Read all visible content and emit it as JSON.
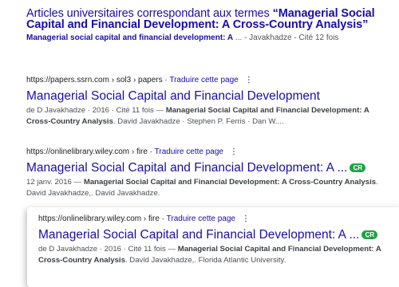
{
  "scholar": {
    "title_prefix": "Articles universitaires correspondant aux termes ",
    "title_query": "“Managerial Social Capital and Financial Development: A Cross-Country Analysis”",
    "sub_link": "Managerial social capital and financial development: A",
    "sub_rest": " ... - Javakhadze - Cité 12 fois"
  },
  "results": [
    {
      "url": "https://papers.ssrn.com › sol3 › papers",
      "separator": " · ",
      "translate": "Traduire cette page",
      "menu": "⋮",
      "title": "Managerial Social Capital and Financial Development",
      "meta": "de D Javakhadze · 2016 · Cité 11 fois — ",
      "bold": "Managerial Social Capital and Financial Development: A Cross-Country Analysis",
      "rest": ". David Javakhadze · Stephen P. Ferris · Dan W...."
    },
    {
      "url": "https://onlinelibrary.wiley.com › fire",
      "separator": " · ",
      "translate": "Traduire cette page",
      "menu": "⋮",
      "title": "Managerial Social Capital and Financial Development: A ...",
      "badge": "C̲R",
      "meta": "12 janv. 2016 — ",
      "bold": "Managerial Social Capital and Financial Development: A Cross-Country Analysis",
      "rest": ". David Javakhadze,. David Javakhadze."
    },
    {
      "url": "https://onlinelibrary.wiley.com › fire",
      "separator": " · ",
      "translate": "Traduire cette page",
      "menu": "⋮",
      "title": "Managerial Social Capital and Financial Development: A ...",
      "badge": "C̲R",
      "meta": "de D Javakhadze · 2016 · Cité 11 fois — ",
      "bold": "Managerial Social Capital and Financial Development: A Cross-Country Analysis",
      "rest": ". David Javakhadze,. Florida Atlantic University."
    }
  ],
  "colors": {
    "link": "#1a0dab",
    "badge": "#1ea345"
  }
}
